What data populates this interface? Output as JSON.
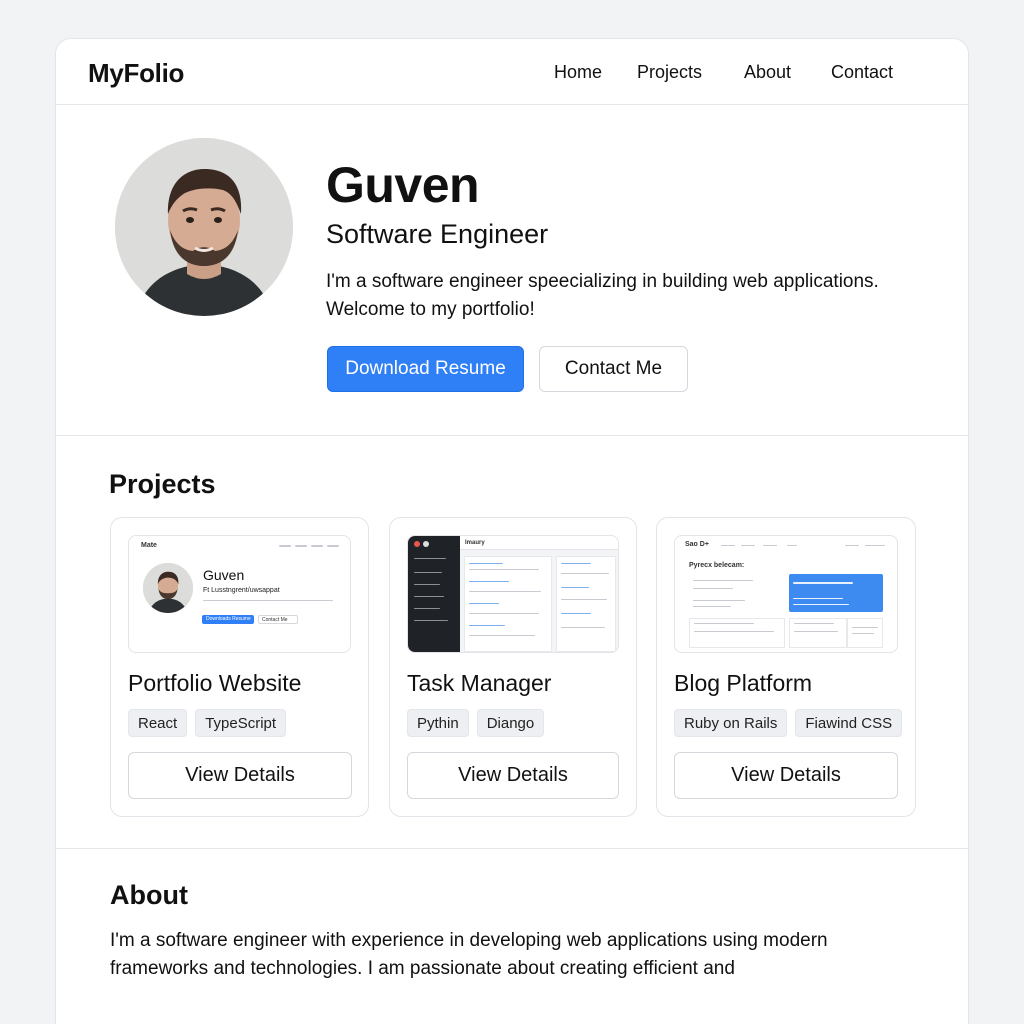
{
  "nav": {
    "brand": "MyFolio",
    "links": [
      "Home",
      "Projects",
      "About",
      "Contact"
    ]
  },
  "hero": {
    "name": "Guven",
    "role": "Software Engineer",
    "bio": "I'm a software engineer speecializing in building web applications. Welcome to my portfolio!",
    "primary_button": "Download Resume",
    "secondary_button": "Contact Me"
  },
  "projects": {
    "title": "Projects",
    "items": [
      {
        "title": "Portfolio Website",
        "tags": [
          "React",
          "TypeScript"
        ],
        "button": "View Details",
        "thumb": {
          "brand": "Mate",
          "name": "Guven",
          "subtitle": "Ft Lusstngrent/uwsappat",
          "btn1": "Downloads Resume",
          "btn2": "Contact Me"
        }
      },
      {
        "title": "Task Manager",
        "tags": [
          "Pythin",
          "Diango"
        ],
        "button": "View Details",
        "thumb": {
          "header": "Imaury"
        }
      },
      {
        "title": "Blog Platform",
        "tags": [
          "Ruby on Rails",
          "Fiawind CSS"
        ],
        "button": "View Details",
        "thumb": {
          "brand": "Sao D+",
          "heading": "Pyrecx belecam:"
        }
      }
    ]
  },
  "about": {
    "title": "About",
    "text": "I'm a software engineer with experience in developing web applications using modern frameworks and technologies. I am passionate about creating efficient and"
  },
  "colors": {
    "accent": "#2f7ff7",
    "page_bg": "#f2f3f5",
    "card_border": "#e1e4e8",
    "tag_bg": "#edeff2",
    "dark_sidebar": "#1f2226"
  }
}
